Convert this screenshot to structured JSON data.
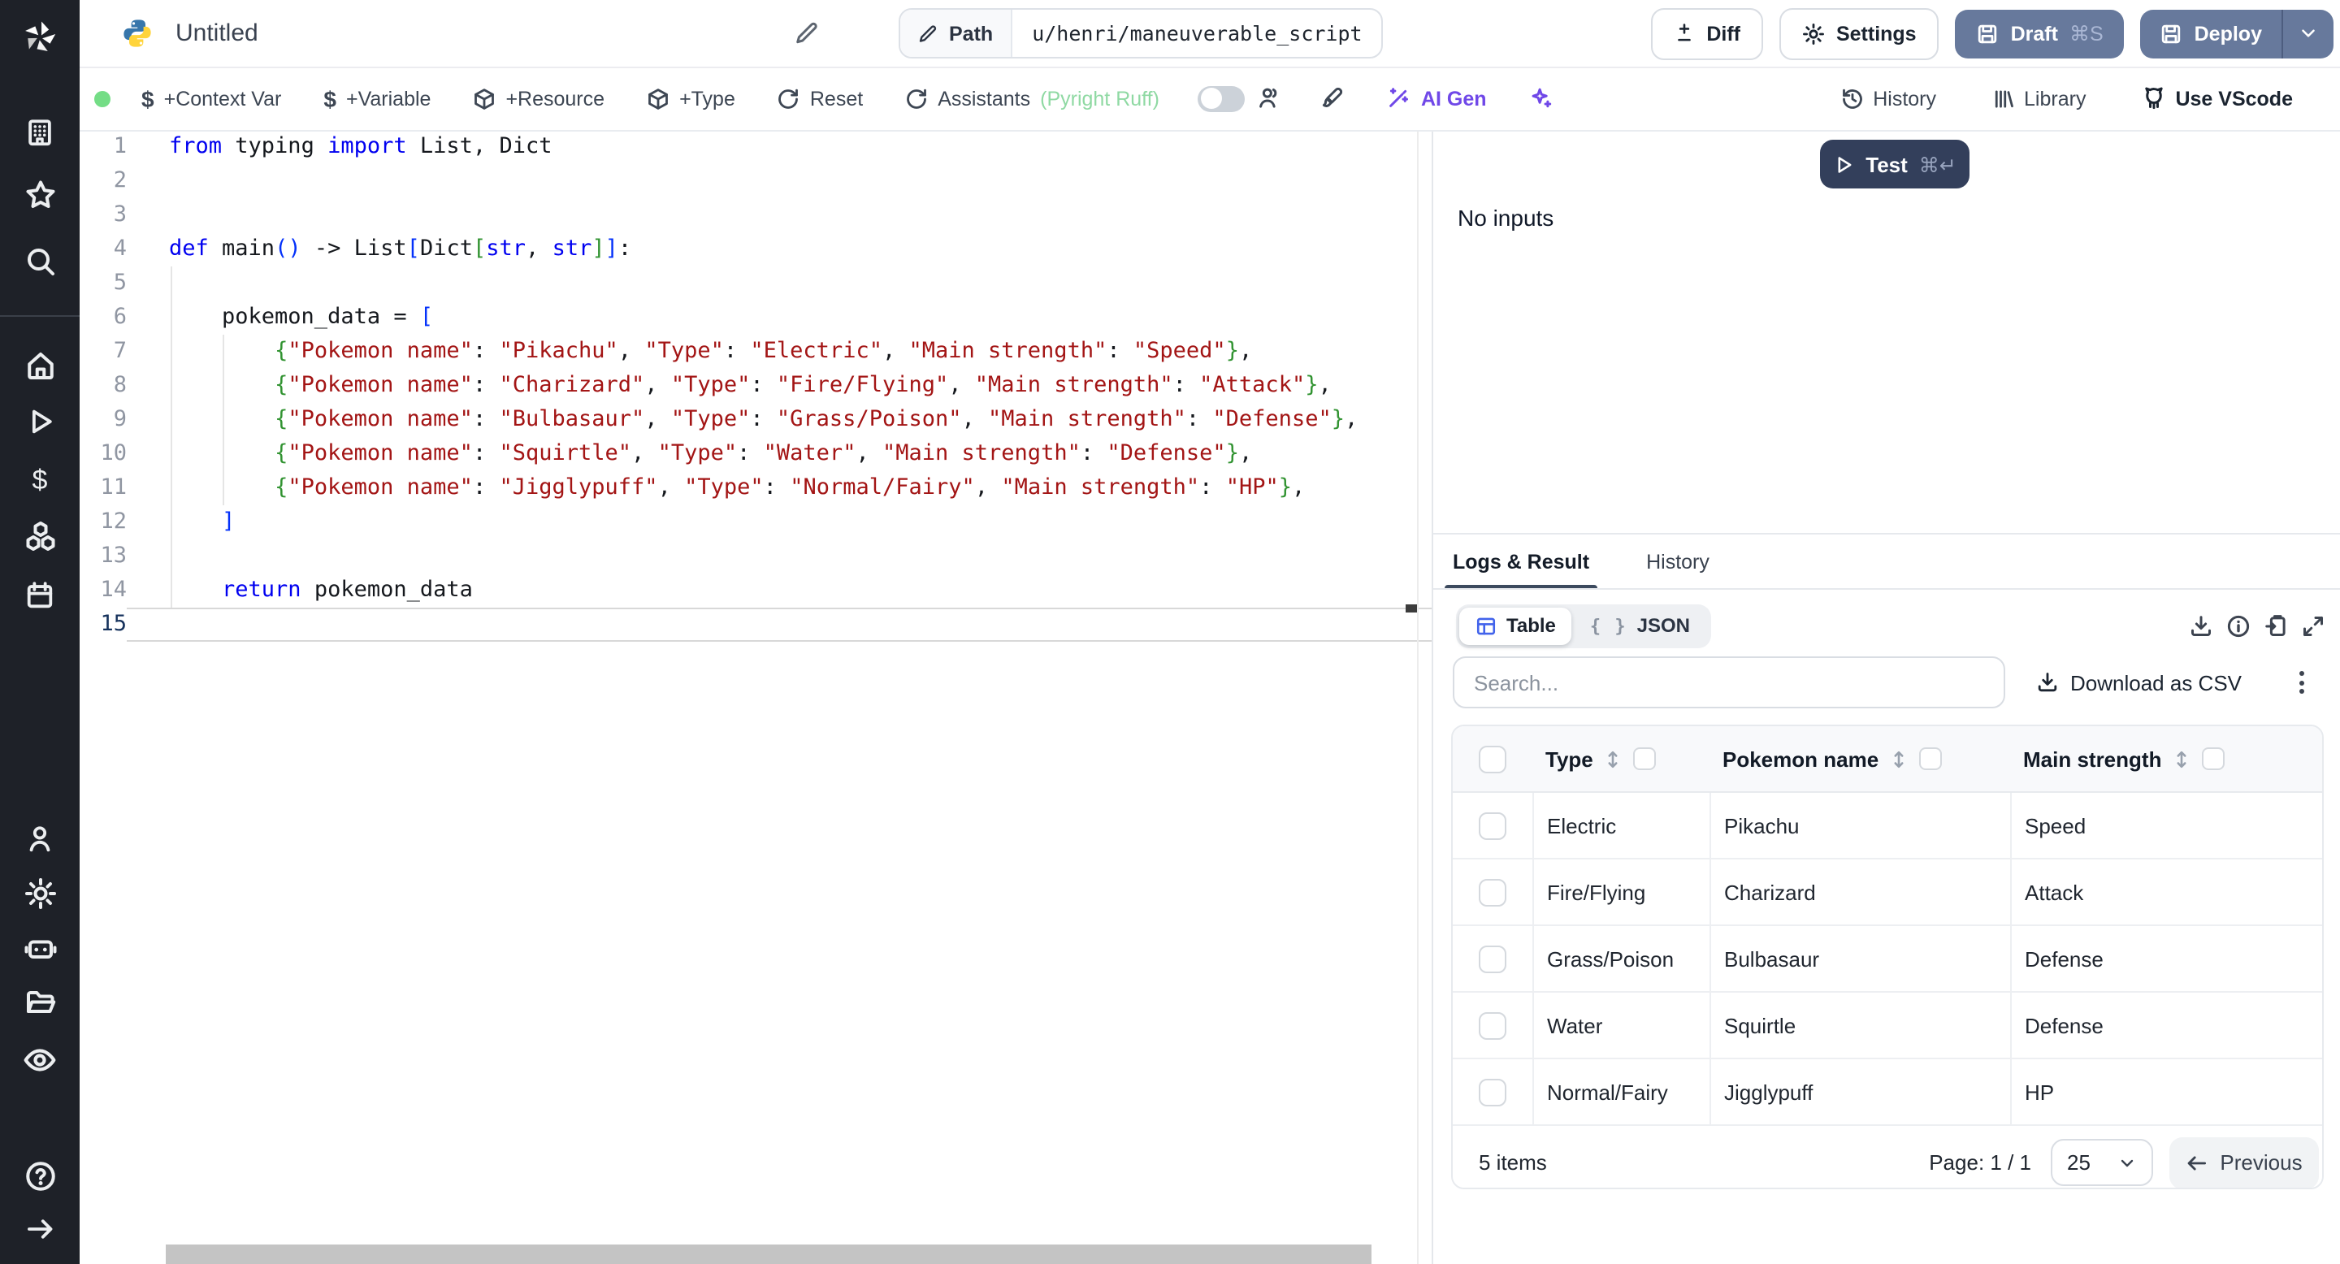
{
  "header": {
    "title": "Untitled",
    "path_label": "Path",
    "path_value": "u/henri/maneuverable_script",
    "diff_label": "Diff",
    "settings_label": "Settings",
    "draft_label": "Draft",
    "draft_shortcut": "⌘S",
    "deploy_label": "Deploy"
  },
  "toolbar": {
    "context_var": "+Context Var",
    "variable": "+Variable",
    "resource": "+Resource",
    "type": "+Type",
    "reset": "Reset",
    "assistants": "Assistants",
    "assistants_detail": "(Pyright Ruff)",
    "ai_gen": "AI Gen",
    "history": "History",
    "library": "Library",
    "vscode": "Use VScode"
  },
  "sidebar_icons": [
    "windmill-logo",
    "building",
    "star",
    "search",
    "home",
    "play",
    "dollar",
    "boxes",
    "calendar",
    "user",
    "gear",
    "robot",
    "folder",
    "eye",
    "help",
    "arrow-right"
  ],
  "editor": {
    "language": "python",
    "active_line": 15,
    "lines": [
      {
        "n": 1,
        "tokens": [
          {
            "t": "kw",
            "v": "from"
          },
          {
            "t": "pl",
            "v": " typing "
          },
          {
            "t": "kw",
            "v": "import"
          },
          {
            "t": "pl",
            "v": " List, Dict"
          }
        ]
      },
      {
        "n": 2,
        "tokens": []
      },
      {
        "n": 3,
        "tokens": []
      },
      {
        "n": 4,
        "tokens": [
          {
            "t": "kw",
            "v": "def"
          },
          {
            "t": "pl",
            "v": " main"
          },
          {
            "t": "b1",
            "v": "()"
          },
          {
            "t": "pl",
            "v": " -> List"
          },
          {
            "t": "b1",
            "v": "["
          },
          {
            "t": "pl",
            "v": "Dict"
          },
          {
            "t": "b2",
            "v": "["
          },
          {
            "t": "ty",
            "v": "str"
          },
          {
            "t": "pl",
            "v": ", "
          },
          {
            "t": "ty",
            "v": "str"
          },
          {
            "t": "b2",
            "v": "]"
          },
          {
            "t": "b1",
            "v": "]"
          },
          {
            "t": "pl",
            "v": ":"
          }
        ]
      },
      {
        "n": 5,
        "tokens": []
      },
      {
        "n": 6,
        "tokens": [
          {
            "t": "pl",
            "v": "    pokemon_data = "
          },
          {
            "t": "b1",
            "v": "["
          }
        ]
      },
      {
        "n": 7,
        "tokens": [
          {
            "t": "pl",
            "v": "        "
          },
          {
            "t": "b2",
            "v": "{"
          },
          {
            "t": "str",
            "v": "\"Pokemon name\""
          },
          {
            "t": "pl",
            "v": ": "
          },
          {
            "t": "str",
            "v": "\"Pikachu\""
          },
          {
            "t": "pl",
            "v": ", "
          },
          {
            "t": "str",
            "v": "\"Type\""
          },
          {
            "t": "pl",
            "v": ": "
          },
          {
            "t": "str",
            "v": "\"Electric\""
          },
          {
            "t": "pl",
            "v": ", "
          },
          {
            "t": "str",
            "v": "\"Main strength\""
          },
          {
            "t": "pl",
            "v": ": "
          },
          {
            "t": "str",
            "v": "\"Speed\""
          },
          {
            "t": "b2",
            "v": "}"
          },
          {
            "t": "pl",
            "v": ","
          }
        ]
      },
      {
        "n": 8,
        "tokens": [
          {
            "t": "pl",
            "v": "        "
          },
          {
            "t": "b2",
            "v": "{"
          },
          {
            "t": "str",
            "v": "\"Pokemon name\""
          },
          {
            "t": "pl",
            "v": ": "
          },
          {
            "t": "str",
            "v": "\"Charizard\""
          },
          {
            "t": "pl",
            "v": ", "
          },
          {
            "t": "str",
            "v": "\"Type\""
          },
          {
            "t": "pl",
            "v": ": "
          },
          {
            "t": "str",
            "v": "\"Fire/Flying\""
          },
          {
            "t": "pl",
            "v": ", "
          },
          {
            "t": "str",
            "v": "\"Main strength\""
          },
          {
            "t": "pl",
            "v": ": "
          },
          {
            "t": "str",
            "v": "\"Attack\""
          },
          {
            "t": "b2",
            "v": "}"
          },
          {
            "t": "pl",
            "v": ","
          }
        ]
      },
      {
        "n": 9,
        "tokens": [
          {
            "t": "pl",
            "v": "        "
          },
          {
            "t": "b2",
            "v": "{"
          },
          {
            "t": "str",
            "v": "\"Pokemon name\""
          },
          {
            "t": "pl",
            "v": ": "
          },
          {
            "t": "str",
            "v": "\"Bulbasaur\""
          },
          {
            "t": "pl",
            "v": ", "
          },
          {
            "t": "str",
            "v": "\"Type\""
          },
          {
            "t": "pl",
            "v": ": "
          },
          {
            "t": "str",
            "v": "\"Grass/Poison\""
          },
          {
            "t": "pl",
            "v": ", "
          },
          {
            "t": "str",
            "v": "\"Main strength\""
          },
          {
            "t": "pl",
            "v": ": "
          },
          {
            "t": "str",
            "v": "\"Defense\""
          },
          {
            "t": "b2",
            "v": "}"
          },
          {
            "t": "pl",
            "v": ","
          }
        ]
      },
      {
        "n": 10,
        "tokens": [
          {
            "t": "pl",
            "v": "        "
          },
          {
            "t": "b2",
            "v": "{"
          },
          {
            "t": "str",
            "v": "\"Pokemon name\""
          },
          {
            "t": "pl",
            "v": ": "
          },
          {
            "t": "str",
            "v": "\"Squirtle\""
          },
          {
            "t": "pl",
            "v": ", "
          },
          {
            "t": "str",
            "v": "\"Type\""
          },
          {
            "t": "pl",
            "v": ": "
          },
          {
            "t": "str",
            "v": "\"Water\""
          },
          {
            "t": "pl",
            "v": ", "
          },
          {
            "t": "str",
            "v": "\"Main strength\""
          },
          {
            "t": "pl",
            "v": ": "
          },
          {
            "t": "str",
            "v": "\"Defense\""
          },
          {
            "t": "b2",
            "v": "}"
          },
          {
            "t": "pl",
            "v": ","
          }
        ]
      },
      {
        "n": 11,
        "tokens": [
          {
            "t": "pl",
            "v": "        "
          },
          {
            "t": "b2",
            "v": "{"
          },
          {
            "t": "str",
            "v": "\"Pokemon name\""
          },
          {
            "t": "pl",
            "v": ": "
          },
          {
            "t": "str",
            "v": "\"Jigglypuff\""
          },
          {
            "t": "pl",
            "v": ", "
          },
          {
            "t": "str",
            "v": "\"Type\""
          },
          {
            "t": "pl",
            "v": ": "
          },
          {
            "t": "str",
            "v": "\"Normal/Fairy\""
          },
          {
            "t": "pl",
            "v": ", "
          },
          {
            "t": "str",
            "v": "\"Main strength\""
          },
          {
            "t": "pl",
            "v": ": "
          },
          {
            "t": "str",
            "v": "\"HP\""
          },
          {
            "t": "b2",
            "v": "}"
          },
          {
            "t": "pl",
            "v": ","
          }
        ]
      },
      {
        "n": 12,
        "tokens": [
          {
            "t": "pl",
            "v": "    "
          },
          {
            "t": "b1",
            "v": "]"
          }
        ]
      },
      {
        "n": 13,
        "tokens": []
      },
      {
        "n": 14,
        "tokens": [
          {
            "t": "pl",
            "v": "    "
          },
          {
            "t": "kw",
            "v": "return"
          },
          {
            "t": "pl",
            "v": " pokemon_data"
          }
        ]
      },
      {
        "n": 15,
        "tokens": []
      }
    ]
  },
  "panel": {
    "test_label": "Test",
    "test_shortcut": "⌘↵",
    "no_inputs": "No inputs",
    "tab_logs": "Logs & Result",
    "tab_history": "History",
    "view_table": "Table",
    "view_json": "JSON",
    "json_braces": "{ }",
    "search_placeholder": "Search...",
    "download_csv": "Download as CSV"
  },
  "result_table": {
    "columns": [
      "Type",
      "Pokemon name",
      "Main strength"
    ],
    "rows": [
      [
        "Electric",
        "Pikachu",
        "Speed"
      ],
      [
        "Fire/Flying",
        "Charizard",
        "Attack"
      ],
      [
        "Grass/Poison",
        "Bulbasaur",
        "Defense"
      ],
      [
        "Water",
        "Squirtle",
        "Defense"
      ],
      [
        "Normal/Fairy",
        "Jigglypuff",
        "HP"
      ]
    ],
    "items_text": "5 items",
    "page_text": "Page: 1 / 1",
    "page_size": "25",
    "previous_label": "Previous"
  },
  "colors": {
    "accent_table_icon": "#4263eb",
    "slate_button": "#67799c",
    "test_button": "#333f5b",
    "status_dot_green": "#74dd86",
    "assistants_green": "#8fd9a3",
    "ai_purple": "#7048e8",
    "code_keyword": "#0000f0",
    "code_string": "#a31515",
    "code_bracket1": "#0431fa",
    "code_bracket2": "#319331",
    "sidebar_bg": "#1e2128"
  }
}
